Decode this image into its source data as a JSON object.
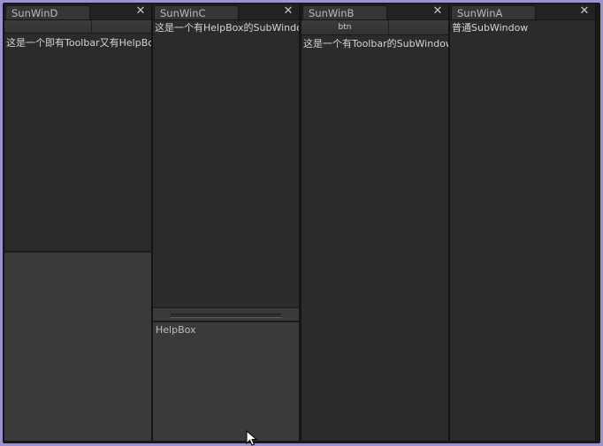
{
  "panels": [
    {
      "key": "D",
      "tab": "SunWinD",
      "close": "✕",
      "label": "这是一个即有Toolbar又有HelpBox的SubWindow",
      "toolbar_button": "",
      "helpbox": ""
    },
    {
      "key": "C",
      "tab": "SunWinC",
      "close": "✕",
      "label": "这是一个有HelpBox的SubWindow",
      "helpbox": "HelpBox"
    },
    {
      "key": "B",
      "tab": "SunWinB",
      "close": "✕",
      "label": "这是一个有Toolbar的SubWindow",
      "toolbar_button": "btn"
    },
    {
      "key": "A",
      "tab": "SunWinA",
      "close": "✕",
      "label": "普通SubWindow"
    }
  ],
  "colors": {
    "desktop": "#9a93cc",
    "panel_bg": "#2b2b2b",
    "helpbox_bg": "#3a3a3a"
  }
}
